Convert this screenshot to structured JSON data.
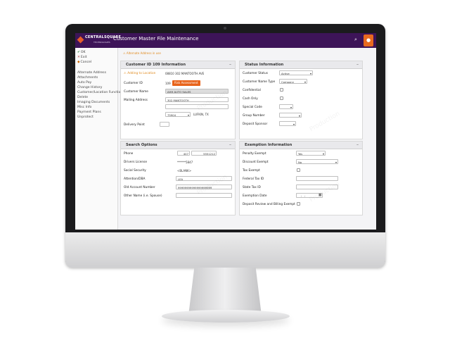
{
  "app": {
    "brand": "CENTRALSQUARE",
    "brand_sub": "TECHNOLOGIES",
    "title": "Customer Master File Maintenance",
    "accent": "#3d1458",
    "action_color": "#e8631a",
    "search_icon": "search-icon",
    "user_icon": "user-icon"
  },
  "sidebar": {
    "actions": [
      {
        "icon": "check-icon",
        "glyph": "✔",
        "label": "OK"
      },
      {
        "icon": "exit-icon",
        "glyph": "✕",
        "label": "Exit"
      },
      {
        "icon": "cancel-icon",
        "glyph": "◆",
        "label": "Cancel"
      }
    ],
    "links": [
      "Alternate Address",
      "Attachments",
      "Auto Pay",
      "Change History",
      "Customer/Location Functio...",
      "Delete",
      "Imaging Documents",
      "Misc Info",
      "Payment Plans",
      "Unprotect"
    ]
  },
  "warning": "Alternate Address in use",
  "customer_panel": {
    "title": "Customer ID 109 Information",
    "adding_label": "Adding to Location",
    "location_value": "08810 302 MANTOOTH AVE",
    "customer_id_label": "Customer ID",
    "customer_id_value": "109",
    "risk_button": "Risk Assessment",
    "customer_name_label": "Customer Name",
    "customer_name_value": "AHH AUTO SALES",
    "mailing_label": "Mailing Address",
    "mailing_value": "302 MANTOOTH",
    "zip_value": "75904",
    "city_value": "LUFKIN, TX",
    "delivery_label": "Delivery Point"
  },
  "status_panel": {
    "title": "Status Information",
    "status_label": "Customer Status",
    "status_value": "Active",
    "name_type_label": "Customer Name Type",
    "name_type_value": "Company",
    "confidential_label": "Confidential",
    "cash_only_label": "Cash Only",
    "special_code_label": "Special Code",
    "group_number_label": "Group Number",
    "deposit_sponsor_label": "Deposit Sponsor"
  },
  "search_panel": {
    "title": "Search Options",
    "phone_label": "Phone",
    "phone_area": "407",
    "phone_number": "5551212",
    "dl_label": "Drivers License",
    "dl_value": "******5847",
    "ssn_label": "Social Security",
    "ssn_value": "<BLANK>",
    "attention_label": "Attention/DBA",
    "attention_value": "LEA",
    "old_account_label": "Old Account Number",
    "old_account_value": "99999999999999999999",
    "other_name_label": "Other Name (i.e. Spouse)"
  },
  "exemption_panel": {
    "title": "Exemption Information",
    "penalty_label": "Penalty Exempt",
    "penalty_value": "Yes",
    "discount_label": "Discount Exempt",
    "discount_value": "No",
    "tax_exempt_label": "Tax Exempt",
    "federal_tax_label": "Federal Tax ID",
    "state_tax_label": "State Tax ID",
    "exemption_date_label": "Exemption Date",
    "exemption_date_placeholder": "__/__/____",
    "deposit_review_label": "Deposit Review and Billing Exempt"
  },
  "watermark": "Production"
}
